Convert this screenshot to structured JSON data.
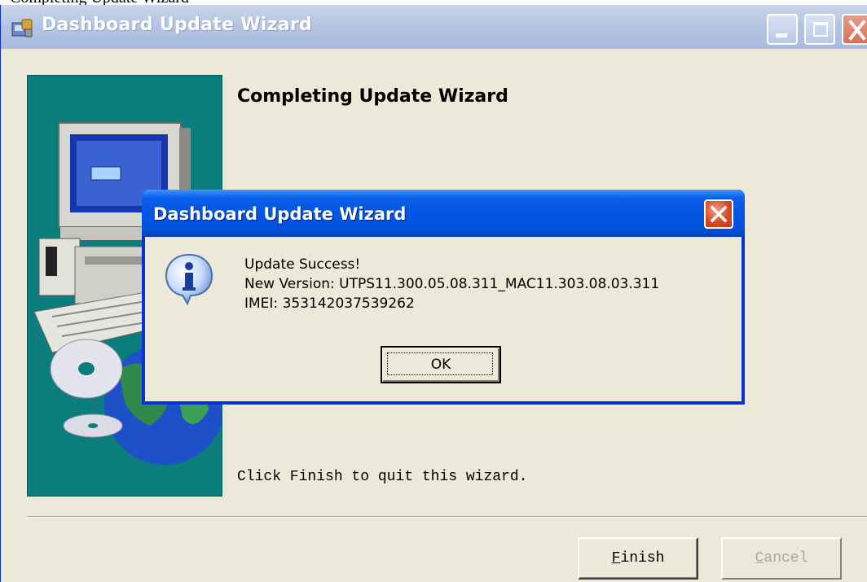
{
  "page_header": {
    "text": "Completing Update Wizard"
  },
  "window": {
    "title": "Dashboard Update Wizard",
    "heading": "Completing Update Wizard",
    "instruction": "Click Finish to quit this wizard.",
    "buttons": {
      "finish": {
        "label_underlined": "F",
        "label_rest": "inish"
      },
      "cancel": {
        "label_underlined": "C",
        "label_rest": "ancel"
      }
    }
  },
  "dialog": {
    "title": "Dashboard Update Wizard",
    "lines": [
      "Update Success!",
      "New Version: UTPS11.300.05.08.311_MAC11.303.08.03.311",
      "IMEI: 353142037539262"
    ],
    "ok_label": "OK"
  },
  "colors": {
    "banner": "#0b7d7d",
    "dialog_title": "#0054e3",
    "window_face": "#ece9d8"
  },
  "icons": [
    "setup-app-icon",
    "minimize-icon",
    "maximize-icon",
    "close-icon",
    "info-icon",
    "computer-cd-globe-illustration"
  ]
}
